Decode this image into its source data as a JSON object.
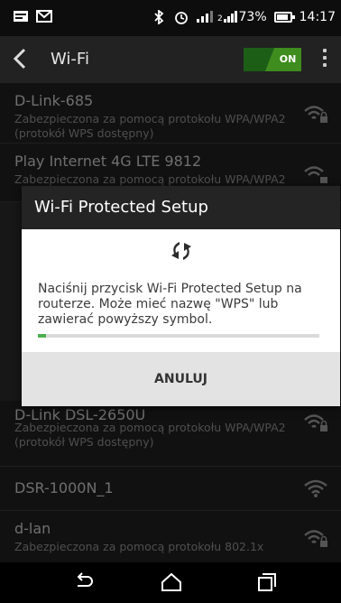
{
  "status_bar": {
    "battery": "73%",
    "time": "14:17"
  },
  "app_bar": {
    "title": "Wi-Fi",
    "toggle_label": "ON"
  },
  "networks": [
    {
      "name": "D-Link-685",
      "security": "Zabezpieczona za pomocą protokołu WPA/WPA2 (protokół WPS dostępny)",
      "locked": true
    },
    {
      "name": "Play Internet 4G LTE 9812",
      "security": "Zabezpieczona za pomocą protokołu WPA/WPA2",
      "locked": true
    },
    {
      "name": "D-Link DSL-2650U",
      "security": "Zabezpieczona za pomocą protokołu WPA/WPA2 (protokół WPS dostępny)",
      "locked": true
    },
    {
      "name": "DSR-1000N_1",
      "security": "",
      "locked": false
    },
    {
      "name": "d-lan",
      "security": "Zabezpieczona za pomocą protokołu 802.1x",
      "locked": true
    }
  ],
  "dialog": {
    "title": "Wi-Fi Protected Setup",
    "message": "Naciśnij przycisk Wi-Fi Protected Setup na routerze. Może mieć nazwę \"WPS\" lub zawierać powyższy symbol.",
    "progress": 0.03,
    "cancel_label": "ANULUJ"
  },
  "colors": {
    "accent_green": "#3f8c1f",
    "progress_green": "#4caf50"
  }
}
